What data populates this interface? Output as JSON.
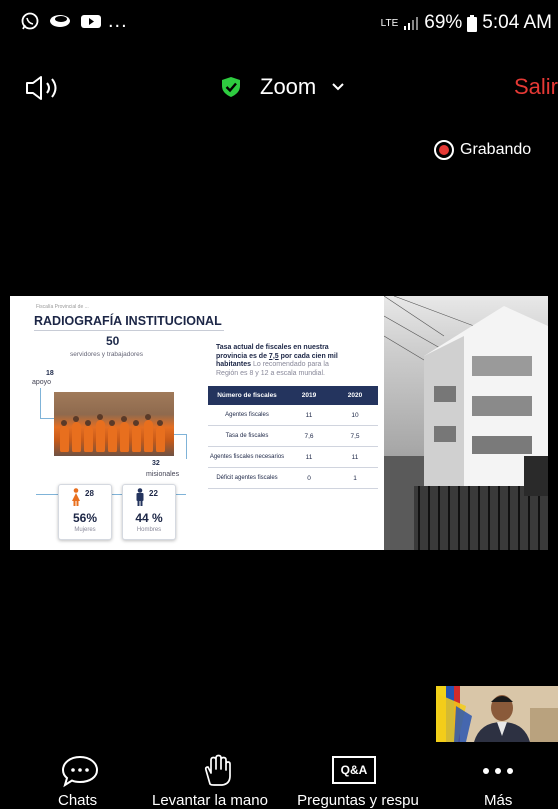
{
  "status_bar": {
    "left_icons": [
      "whatsapp-icon",
      "chat-bubble-icon",
      "youtube-icon"
    ],
    "more": "...",
    "network": "LTE",
    "battery": "69%",
    "time": "5:04 AM"
  },
  "header": {
    "speaker_icon": "speaker-icon",
    "title": "Zoom",
    "leave": "Salir"
  },
  "recording": {
    "label": "Grabando"
  },
  "slide": {
    "pretitle": "Fiscalía Provincial de ...",
    "title": "RADIOGRAFÍA INSTITUCIONAL",
    "total": "50",
    "total_label": "servidores y trabajadores",
    "apoyo_count": "18",
    "apoyo_label": "apoyo",
    "misionales_count": "32",
    "misionales_label": "misionales",
    "women": {
      "count": "28",
      "pct": "56%",
      "label": "Mujeres"
    },
    "men": {
      "count": "22",
      "pct": "44 %",
      "label": "Hombres"
    },
    "tasa": {
      "line1": "Tasa actual de fiscales en nuestra",
      "line2_pre": "provincia es de ",
      "line2_val": "7,5",
      "line2_post": " por cada cien mil",
      "line3_bold": "habitantes",
      "line3_rest": " Lo recomendado para la",
      "line4": "Región es 8 y 12 a escala mundial."
    },
    "table": {
      "headers": [
        "Número de fiscales",
        "2019",
        "2020"
      ],
      "rows": [
        [
          "Agentes fiscales",
          "11",
          "10"
        ],
        [
          "Tasa de fiscales",
          "7,6",
          "7,5"
        ],
        [
          "Agentes fiscales necesarios",
          "11",
          "11"
        ],
        [
          "Déficit agentes fiscales",
          "0",
          "1"
        ]
      ]
    }
  },
  "toolbar": {
    "chats": "Chats",
    "raise_hand": "Levantar la mano",
    "qa_icon_text": "Q&A",
    "qa": "Preguntas y respu",
    "more": "Más"
  },
  "colors": {
    "leave": "#e53935",
    "shield": "#2ecc40",
    "slide_navy": "#24345e",
    "orange": "#e86f1e"
  }
}
